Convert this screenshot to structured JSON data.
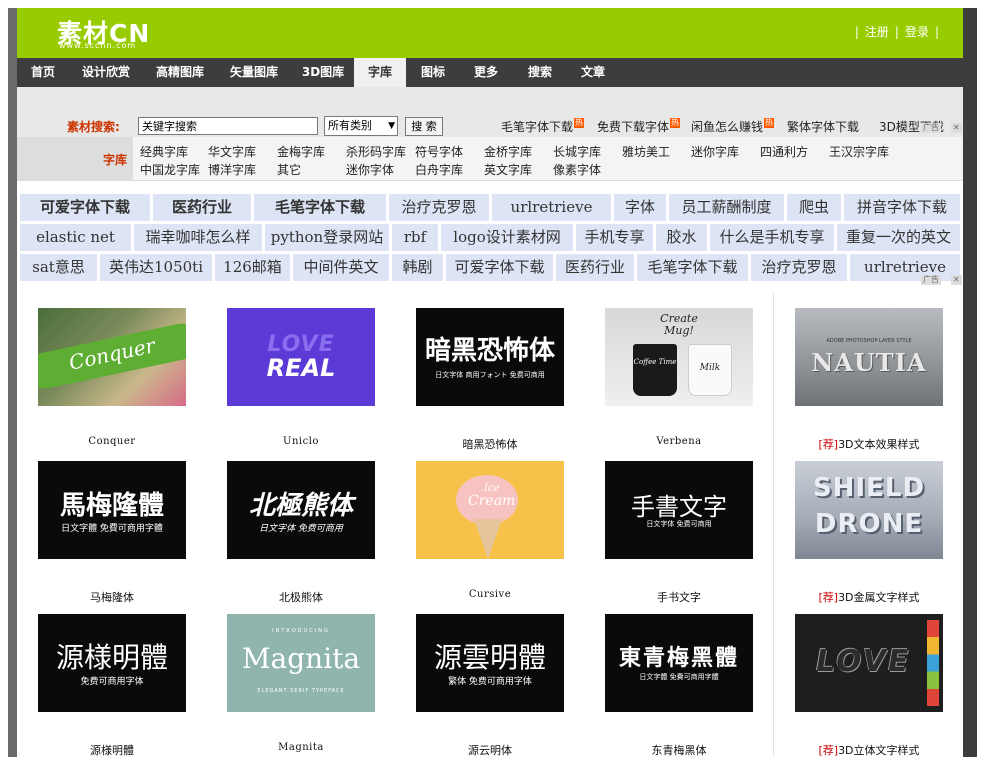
{
  "logo": {
    "text": "素材CN",
    "sub": "www.sccnn.com"
  },
  "header": {
    "register": "注册",
    "login": "登录"
  },
  "nav": [
    "首页",
    "设计欣赏",
    "高精图库",
    "矢量图库",
    "3D图库",
    "字库",
    "图标",
    "更多",
    "搜索",
    "文章"
  ],
  "nav_active": "字库",
  "search": {
    "label": "素材搜索:",
    "placeholder": "关键字搜索",
    "category": "所有类别",
    "button": "搜 索",
    "hot_links": [
      {
        "text": "毛笔字体下载",
        "hot": true
      },
      {
        "text": "免费下载字体",
        "hot": true
      },
      {
        "text": "闲鱼怎么赚钱",
        "hot": true
      },
      {
        "text": "繁体字体下载",
        "hot": false
      },
      {
        "text": "3D模型下载",
        "hot": false
      }
    ],
    "hot_badge": "热",
    "ad_label": "广告"
  },
  "library": {
    "label": "字库",
    "row1": [
      "经典字库",
      "华文字库",
      "金梅字库",
      "杀形码字库",
      "符号字体",
      "金桥字库",
      "长城字库",
      "雅坊美工",
      "迷你字库",
      "四通利方",
      "王汉宗字库"
    ],
    "row2": [
      "中国龙字库",
      "博洋字库",
      "其它",
      "迷你字体",
      "白舟字库",
      "英文字库",
      "像素字体"
    ]
  },
  "tags": {
    "row1": [
      "可爱字体下载",
      "医药行业",
      "毛笔字体下载",
      "治疗克罗恩",
      "urlretrieve",
      "字体",
      "员工薪酬制度",
      "爬虫",
      "拼音字体下载"
    ],
    "row2": [
      "elastic net",
      "瑞幸咖啡怎么样",
      "python登录网站",
      "rbf",
      "logo设计素材网",
      "手机专享",
      "胶水",
      "什么是手机专享",
      "重复一次的英文"
    ],
    "row3": [
      "sat意思",
      "英伟达1050ti",
      "126邮箱",
      "中间件英文",
      "韩剧",
      "可爱字体下载",
      "医药行业",
      "毛笔字体下载",
      "治疗克罗恩",
      "urlretrieve"
    ]
  },
  "cards": {
    "row1": [
      {
        "title": "Conquer",
        "art": "Conquer"
      },
      {
        "title": "Uniclo",
        "art_top": "LOVE",
        "art_bottom": "REAL"
      },
      {
        "title": "暗黑恐怖体",
        "art": "暗黑恐怖体",
        "art_sub": "日文字体 商用フォント 免费可商用"
      },
      {
        "title": "Verbena",
        "art_top": "Create",
        "art_bottom": "Mug!",
        "art_cup_left": "Coffee Time",
        "art_cup_right": "Milk"
      },
      {
        "title": "3D文本效果样式",
        "rec": "[荐]",
        "art_top": "ADOBE PHOTOSHOP LAYER STYLE",
        "art_bottom": "NAUTIA"
      }
    ],
    "row2": [
      {
        "title": "马梅隆体",
        "art": "馬梅隆體",
        "art_sub": "日文字體 免費可商用字體"
      },
      {
        "title": "北极熊体",
        "art": "北極熊体",
        "art_sub": "日文字体 免费可商用"
      },
      {
        "title": "Cursive",
        "art_top": "Ice",
        "art_bottom": "Cream"
      },
      {
        "title": "手书文字",
        "art": "手書文字",
        "art_sub": "日文字体 免费可商用"
      },
      {
        "title": "3D金属文字样式",
        "rec": "[荐]",
        "art_top": "SHIELD",
        "art_bottom": "DRONE"
      }
    ],
    "row3": [
      {
        "title": "源様明體",
        "art": "源様明體",
        "art_sub": "免费可商用字体"
      },
      {
        "title": "Magnita",
        "art_top": "INTRODUCING",
        "art": "Magnita",
        "art_sub": "ELEGANT SERIF TYPEFACE"
      },
      {
        "title": "源云明体",
        "art": "源雲明體",
        "art_sub": "繁体 免费可商用字体"
      },
      {
        "title": "东青梅黑体",
        "art": "東青梅黑體",
        "art_sub": "日文字體 免費可商用字體"
      },
      {
        "title": "3D立体文字样式",
        "rec": "[荐]",
        "art": "LOVE"
      }
    ]
  },
  "colors": {
    "header": "#99cc00",
    "nav": "#3d3d3d",
    "accent": "#cc3300",
    "tag_bg": "#dde4f5"
  }
}
